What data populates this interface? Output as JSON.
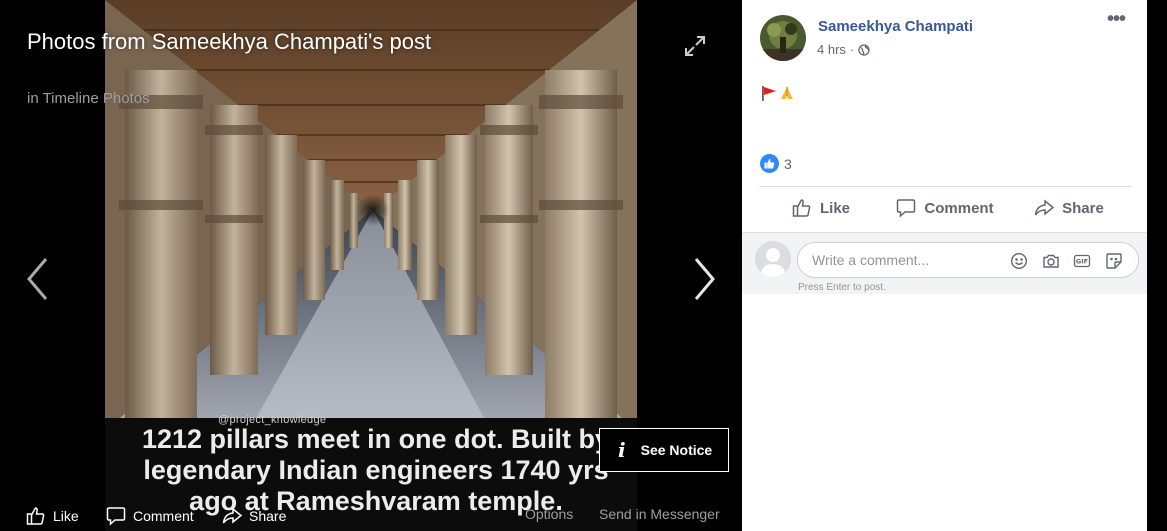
{
  "viewer": {
    "title": "Photos from Sameekhya Champati's post",
    "subtitle": "in Timeline Photos",
    "caption_lines": [
      "1212 pillars meet in one dot. Built by",
      "legendary Indian engineers 1740 yrs",
      "ago at Rameshvaram temple."
    ],
    "watermark": "@project_knowledge",
    "see_notice_label": "See Notice",
    "bottom_bar": {
      "like": "Like",
      "comment": "Comment",
      "share": "Share",
      "options": "Options",
      "send_in_messenger": "Send in Messenger"
    }
  },
  "post": {
    "author": "Sameekhya Champati",
    "time": "4 hrs",
    "audience_icon": "globe-icon",
    "body_emojis": [
      "red-flag-icon",
      "folded-hands-icon"
    ],
    "reaction_count": "3",
    "actions": {
      "like": "Like",
      "comment": "Comment",
      "share": "Share"
    },
    "comment_box": {
      "placeholder": "Write a comment...",
      "hint": "Press Enter to post.",
      "icons": [
        "emoji-icon",
        "camera-icon",
        "gif-icon",
        "sticker-icon"
      ]
    }
  },
  "colors": {
    "author_link": "#385898",
    "like_badge": "#2e89ff",
    "secondary_text": "#606770"
  }
}
